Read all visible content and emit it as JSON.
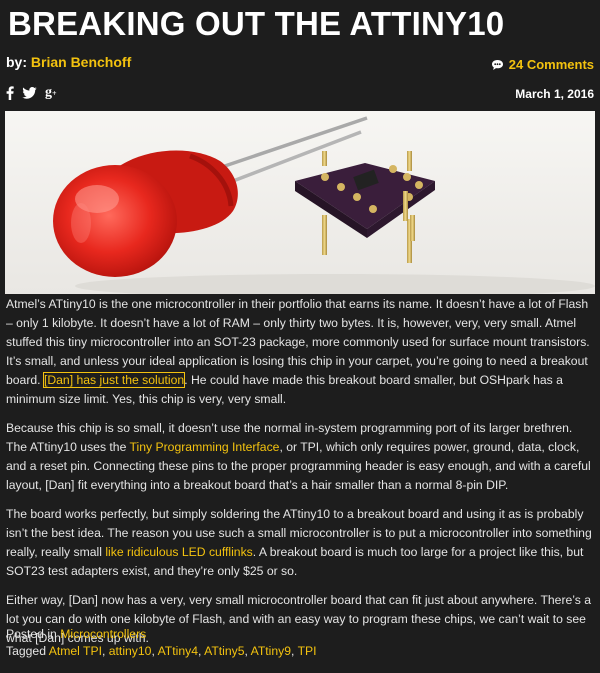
{
  "post": {
    "title": "BREAKING OUT THE ATTINY10",
    "by_label": "by:",
    "author": "Brian Benchoff",
    "comments": "24 Comments",
    "date": "March 1, 2016"
  },
  "social": {
    "facebook": "f",
    "gplus": "g",
    "gplus_sup": "+"
  },
  "icons": {
    "comments": "speech-bubble-icon",
    "facebook": "facebook-icon",
    "twitter": "twitter-icon",
    "gplus": "google-plus-icon"
  },
  "colors": {
    "accent": "#f3c20f",
    "background": "#1d1d1d",
    "text": "#e4e4e4"
  },
  "body": {
    "p1_a": "Atmel’s ATtiny10 is the one microcontroller in their portfolio that earns its name. It doesn’t have a lot of Flash – only 1 kilobyte. It doesn’t have a lot of RAM – only thirty two bytes. It is, however, very, very small. Atmel stuffed this tiny microcontroller into an SOT-23 package, more commonly used for surface mount transistors. It’s small, and unless your ideal application is losing this chip in your carpet, you’re going to need a breakout board. ",
    "p1_link": "[Dan] has just the solution",
    "p1_b": ". He could have made this breakout board smaller, but OSHpark has a minimum size limit. Yes, this chip is very, very small.",
    "p2_a": "Because this chip is so small, it doesn’t use the normal in-system programming port of its larger brethren. The ATtiny10 uses the ",
    "p2_link": "Tiny Programming Interface",
    "p2_b": ", or TPI, which only requires power, ground, data, clock, and a reset pin. Connecting these pins to the proper programming header is easy enough, and with a careful layout, [Dan] fit everything into a breakout board that’s a hair smaller than a normal 8-pin DIP.",
    "p3_a": "The board works perfectly, but simply soldering the ATtiny10 to a breakout board and using it as is probably isn’t the best idea. The reason you use such a small microcontroller is to put a microcontroller into something really, really small ",
    "p3_link": "like ridiculous LED cufflinks",
    "p3_b": ". A breakout board is much too large for a project like this, but SOT23 test adapters exist, and they’re only $25 or so.",
    "p4": "Either way, [Dan] now has a very, very small microcontroller board that can fit just about anywhere. There’s a lot you can do with one kilobyte of Flash, and with an easy way to program these chips, we can’t wait to see what [Dan] comes up with."
  },
  "meta": {
    "posted_in_label": "Posted in",
    "category": "Microcontrollers",
    "tagged_label": "Tagged",
    "tags": [
      "Atmel TPI",
      "attiny10",
      "ATtiny4",
      "ATtiny5",
      "ATtiny9",
      "TPI"
    ],
    "tag_separator": ", "
  }
}
